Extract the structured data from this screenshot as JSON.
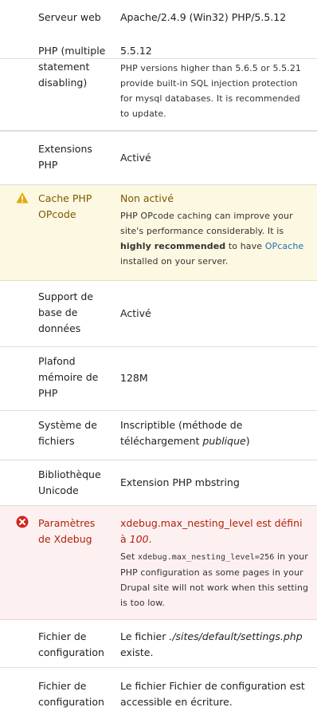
{
  "rows": {
    "server": {
      "label": "Serveur web",
      "value": "Apache/2.4.9 (Win32) PHP/5.5.12"
    },
    "php": {
      "label": "PHP (multiple statement disabling)",
      "value": "5.5.12",
      "desc": "PHP versions higher than 5.6.5 or 5.5.21 provide built-in SQL injection protection for mysql databases. It is recommended to update."
    },
    "ext": {
      "label": "Extensions PHP",
      "value": "Activé"
    },
    "opcode": {
      "label": "Cache PHP OPcode",
      "value": "Non activé",
      "desc_part1": "PHP OPcode caching can improve your site's performance considerably. It is ",
      "desc_strong": "highly recommended",
      "desc_part2": " to have ",
      "desc_link": "OPcache",
      "desc_part3": " installed on your server."
    },
    "db": {
      "label": "Support de base de données",
      "value": "Activé"
    },
    "memory": {
      "label": "Plafond mémoire de PHP",
      "value": "128M"
    },
    "fs": {
      "label": "Système de fichiers",
      "value_part1": "Inscriptible (méthode de téléchargement ",
      "value_em": "publique",
      "value_part2": ")"
    },
    "unicode": {
      "label": "Bibliothèque Unicode",
      "value": "Extension PHP mbstring"
    },
    "xdebug": {
      "label": "Paramètres de Xdebug",
      "value_part1": "xdebug.max_nesting_level est défini à ",
      "value_em": "100",
      "value_part2": ".",
      "desc_part1": "Set ",
      "desc_code": "xdebug.max_nesting_level=256",
      "desc_part2": " in your PHP configuration as some pages in your Drupal site will not work when this setting is too low."
    },
    "config_exists": {
      "label": "Fichier de configuration",
      "value_part1": "Le fichier ",
      "value_em": "./sites/default/settings.php",
      "value_part2": " existe."
    },
    "config_writable": {
      "label": "Fichier de configuration",
      "value": "Le fichier Fichier de configuration est accessible en écriture."
    }
  },
  "colors": {
    "warning_bg": "#fdf8e1",
    "warning_icon": "#e0a800",
    "error_bg": "#fcf1f0",
    "error_icon": "#d0261b",
    "link": "#1f6fb5"
  },
  "icons": {
    "warning": "warning-icon",
    "error": "error-icon"
  }
}
